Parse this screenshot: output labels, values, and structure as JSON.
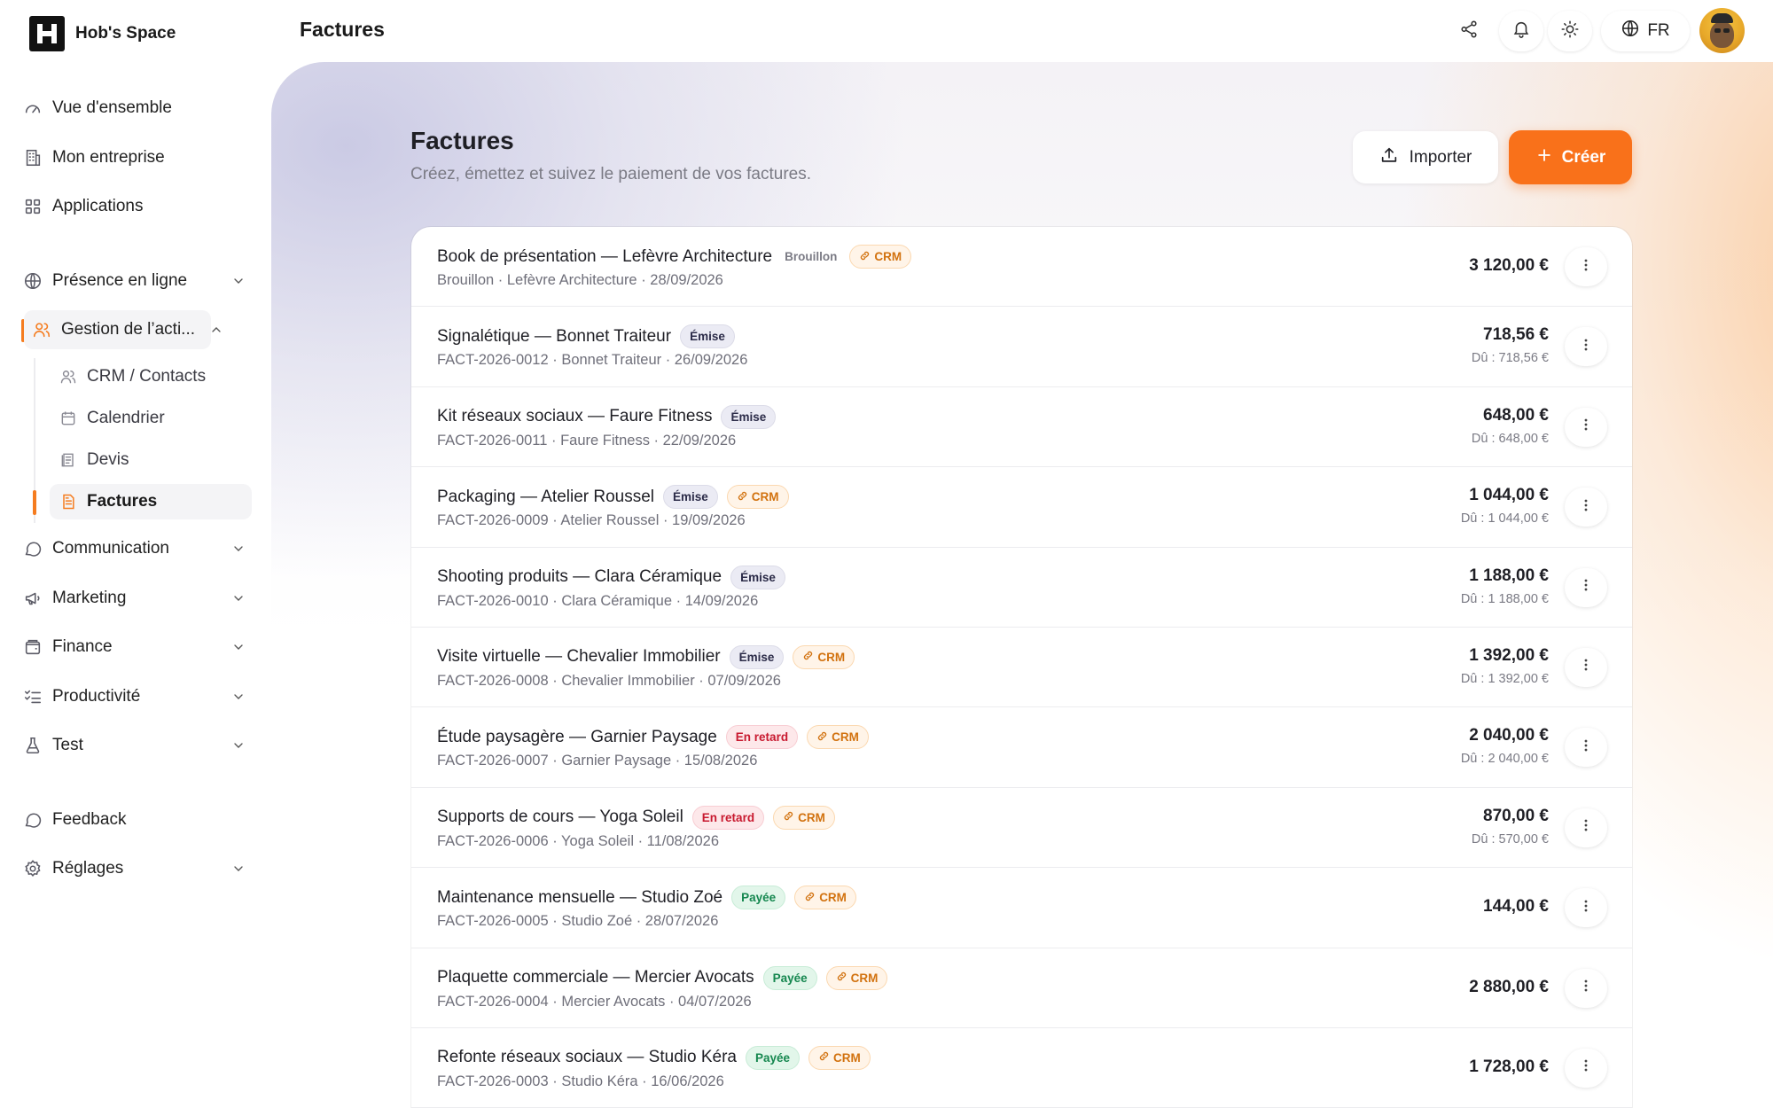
{
  "brand": {
    "name": "Hob's Space"
  },
  "topbar": {
    "title": "Factures",
    "lang": "FR"
  },
  "sidebar": {
    "items": [
      {
        "label": "Vue d'ensemble",
        "icon": "gauge-icon"
      },
      {
        "label": "Mon entreprise",
        "icon": "building-icon"
      },
      {
        "label": "Applications",
        "icon": "grid-icon"
      },
      {
        "label": "Présence en ligne",
        "icon": "globe-icon"
      },
      {
        "label": "Gestion de l’acti...",
        "icon": "users-icon"
      },
      {
        "label": "Communication",
        "icon": "chat-icon"
      },
      {
        "label": "Marketing",
        "icon": "megaphone-icon"
      },
      {
        "label": "Finance",
        "icon": "wallet-icon"
      },
      {
        "label": "Productivité",
        "icon": "checklist-icon"
      },
      {
        "label": "Test",
        "icon": "flask-icon"
      },
      {
        "label": "Feedback",
        "icon": "feedback-icon"
      },
      {
        "label": "Réglages",
        "icon": "gear-icon"
      }
    ],
    "sub_items": [
      {
        "label": "CRM / Contacts",
        "icon": "contacts-icon"
      },
      {
        "label": "Calendrier",
        "icon": "calendar-icon"
      },
      {
        "label": "Devis",
        "icon": "quote-icon"
      },
      {
        "label": "Factures",
        "icon": "invoice-icon"
      }
    ]
  },
  "page": {
    "title": "Factures",
    "subtitle": "Créez, émettez et suivez le paiement de vos factures.",
    "import_label": "Importer",
    "create_label": "Créer"
  },
  "invoices": [
    {
      "title": "Book de présentation — Lefèvre Architecture",
      "status": "Brouillon",
      "status_kind": "draft",
      "crm": "CRM",
      "meta": "Brouillon · Lefèvre Architecture · 28/09/2026",
      "amount": "3 120,00 €",
      "due": ""
    },
    {
      "title": "Signalétique — Bonnet Traiteur",
      "status": "Émise",
      "status_kind": "emise",
      "crm": "",
      "meta": "FACT-2026-0012 · Bonnet Traiteur · 26/09/2026",
      "amount": "718,56 €",
      "due": "Dû : 718,56 €"
    },
    {
      "title": "Kit réseaux sociaux — Faure Fitness",
      "status": "Émise",
      "status_kind": "emise",
      "crm": "",
      "meta": "FACT-2026-0011 · Faure Fitness · 22/09/2026",
      "amount": "648,00 €",
      "due": "Dû : 648,00 €"
    },
    {
      "title": "Packaging — Atelier Roussel",
      "status": "Émise",
      "status_kind": "emise",
      "crm": "CRM",
      "meta": "FACT-2026-0009 · Atelier Roussel · 19/09/2026",
      "amount": "1 044,00 €",
      "due": "Dû : 1 044,00 €"
    },
    {
      "title": "Shooting produits — Clara Céramique",
      "status": "Émise",
      "status_kind": "emise",
      "crm": "",
      "meta": "FACT-2026-0010 · Clara Céramique · 14/09/2026",
      "amount": "1 188,00 €",
      "due": "Dû : 1 188,00 €"
    },
    {
      "title": "Visite virtuelle — Chevalier Immobilier",
      "status": "Émise",
      "status_kind": "emise",
      "crm": "CRM",
      "meta": "FACT-2026-0008 · Chevalier Immobilier · 07/09/2026",
      "amount": "1 392,00 €",
      "due": "Dû : 1 392,00 €"
    },
    {
      "title": "Étude paysagère — Garnier Paysage",
      "status": "En retard",
      "status_kind": "late",
      "crm": "CRM",
      "meta": "FACT-2026-0007 · Garnier Paysage · 15/08/2026",
      "amount": "2 040,00 €",
      "due": "Dû : 2 040,00 €"
    },
    {
      "title": "Supports de cours — Yoga Soleil",
      "status": "En retard",
      "status_kind": "late",
      "crm": "CRM",
      "meta": "FACT-2026-0006 · Yoga Soleil · 11/08/2026",
      "amount": "870,00 €",
      "due": "Dû : 570,00 €"
    },
    {
      "title": "Maintenance mensuelle — Studio Zoé",
      "status": "Payée",
      "status_kind": "paid",
      "crm": "CRM",
      "meta": "FACT-2026-0005 · Studio Zoé · 28/07/2026",
      "amount": "144,00 €",
      "due": ""
    },
    {
      "title": "Plaquette commerciale — Mercier Avocats",
      "status": "Payée",
      "status_kind": "paid",
      "crm": "CRM",
      "meta": "FACT-2026-0004 · Mercier Avocats · 04/07/2026",
      "amount": "2 880,00 €",
      "due": ""
    },
    {
      "title": "Refonte réseaux sociaux — Studio Kéra",
      "status": "Payée",
      "status_kind": "paid",
      "crm": "CRM",
      "meta": "FACT-2026-0003 · Studio Kéra · 16/06/2026",
      "amount": "1 728,00 €",
      "due": ""
    }
  ],
  "colors": {
    "accent": "#f9711a",
    "late": "#c8192f",
    "paid": "#15874f",
    "crm": "#d2720f"
  }
}
